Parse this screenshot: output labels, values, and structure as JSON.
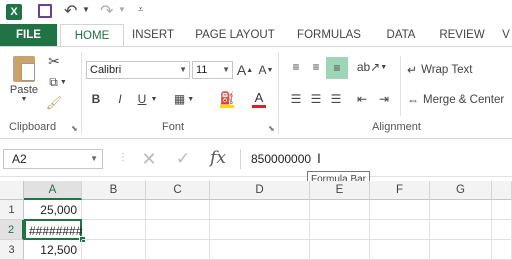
{
  "quick_access": {
    "save_icon": "save-icon",
    "undo_icon": "undo-icon",
    "redo_icon": "redo-icon"
  },
  "tabs": [
    "FILE",
    "HOME",
    "INSERT",
    "PAGE LAYOUT",
    "FORMULAS",
    "DATA",
    "REVIEW",
    "V"
  ],
  "clipboard": {
    "paste_label": "Paste",
    "group_label": "Clipboard"
  },
  "font": {
    "name": "Calibri",
    "size": "11",
    "group_label": "Font",
    "bold": "B",
    "italic": "I",
    "underline": "U",
    "color_label": "A"
  },
  "alignment": {
    "wrap_text": "Wrap Text",
    "merge_center": "Merge & Center",
    "group_label": "Alignment"
  },
  "formula_bar": {
    "name_box": "A2",
    "value": "850000000",
    "tooltip": "Formula Bar",
    "fx": "fx"
  },
  "sheet": {
    "columns": [
      "A",
      "B",
      "C",
      "D",
      "E",
      "F",
      "G"
    ],
    "rows": [
      {
        "num": "1",
        "a": "25,000"
      },
      {
        "num": "2",
        "a": "########"
      },
      {
        "num": "3",
        "a": "12,500"
      }
    ]
  },
  "colors": {
    "accent": "#217346",
    "font_color_bar": "#e02020",
    "highlight": "#ffd800"
  }
}
